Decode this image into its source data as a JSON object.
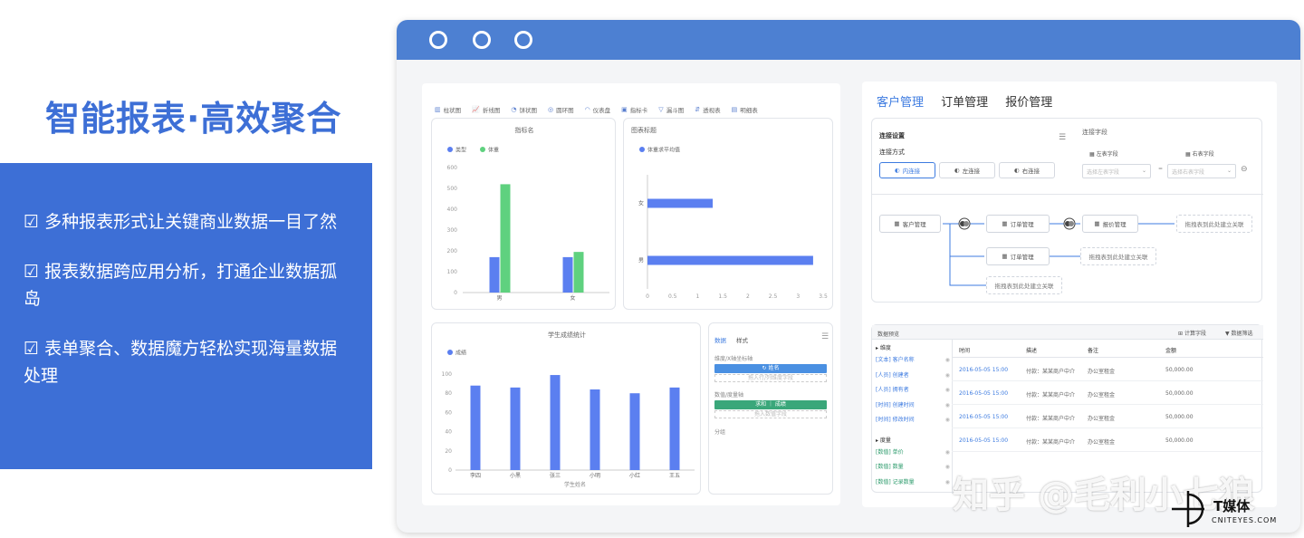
{
  "headline": "智能报表·高效聚合",
  "features": [
    "☑ 多种报表形式让关键商业数据一目了然",
    "☑ 报表数据跨应用分析，打通企业数据孤岛",
    "☑ 表单聚合、数据魔方轻松实现海量数据处理"
  ],
  "report": {
    "toolbar": [
      {
        "icon": "bar-chart-icon",
        "label": "柱状图"
      },
      {
        "icon": "line-chart-icon",
        "label": "折线图"
      },
      {
        "icon": "pie-chart-icon",
        "label": "饼状图"
      },
      {
        "icon": "ring-chart-icon",
        "label": "圆环图"
      },
      {
        "icon": "gauge-icon",
        "label": "仪表盘"
      },
      {
        "icon": "indicator-card-icon",
        "label": "指标卡"
      },
      {
        "icon": "funnel-icon",
        "label": "漏斗图"
      },
      {
        "icon": "pivot-table-icon",
        "label": "透视表"
      },
      {
        "icon": "detail-table-icon",
        "label": "明细表"
      }
    ],
    "chart1": {
      "title": "指标名",
      "legend": [
        "类型",
        "体重"
      ]
    },
    "chart2": {
      "title": "图表标题",
      "legend": [
        "体重求平均值"
      ]
    },
    "chart3": {
      "title": "学生成绩统计",
      "legend": [
        "成绩"
      ],
      "xlabel": "学生姓名"
    },
    "config": {
      "tabs": [
        "数据",
        "样式"
      ],
      "dim_label": "维度/X轴坐标轴",
      "dim_chip": "↻ 姓名",
      "dim_hint": "拖入行/列维度字段",
      "metric_label": "数值/度量轴",
      "metric_chip": "求和 ｜ 成绩",
      "metric_hint": "拖入数值字段",
      "filter_label": "分组"
    }
  },
  "chart_data": [
    {
      "type": "bar",
      "title": "指标名",
      "categories": [
        "男",
        "女"
      ],
      "series": [
        {
          "name": "类型",
          "values": [
            170,
            170
          ]
        },
        {
          "name": "体重",
          "values": [
            520,
            195
          ]
        }
      ],
      "ylim": [
        0,
        600
      ],
      "yticks": [
        0,
        100,
        200,
        300,
        400,
        500,
        600
      ],
      "colors": [
        "#5b7ff0",
        "#5fd17f"
      ],
      "legend": "top-left"
    },
    {
      "type": "bar",
      "orientation": "horizontal",
      "title": "图表标题",
      "categories": [
        "女",
        "男"
      ],
      "series": [
        {
          "name": "体重求平均值",
          "values": [
            1.3,
            3.3
          ]
        }
      ],
      "xlim": [
        0,
        3.5
      ],
      "xticks": [
        "0",
        "0.5",
        "1",
        "1.5",
        "2",
        "2.5",
        "3",
        "3.5"
      ],
      "colors": [
        "#5b7ff0"
      ]
    },
    {
      "type": "bar",
      "title": "学生成绩统计",
      "categories": [
        "李四",
        "小黑",
        "张三",
        "小明",
        "小红",
        "王五"
      ],
      "series": [
        {
          "name": "成绩",
          "values": [
            88,
            86,
            99,
            84,
            80,
            86
          ]
        }
      ],
      "ylim": [
        0,
        100
      ],
      "yticks": [
        0,
        20,
        40,
        60,
        80,
        100
      ],
      "xlabel": "学生姓名",
      "colors": [
        "#5b7ff0"
      ]
    }
  ],
  "right": {
    "tabs": [
      "客户管理",
      "订单管理",
      "报价管理"
    ],
    "conn": {
      "title": "连接设置",
      "method": "连接方式",
      "buttons": [
        "内连接",
        "左连接",
        "右连接"
      ],
      "fields_title": "连接字段",
      "left_field": "左表字段",
      "right_field": "右表字段",
      "left_placeholder": "选择左表字段",
      "right_placeholder": "选择右表字段",
      "flow": [
        "客户管理",
        "订单管理",
        "报价管理",
        "订单管理"
      ],
      "drop_hint": "拖拽表到此处建立关联"
    },
    "preview": {
      "title": "数据预览",
      "calc_btn": "计算字段",
      "filter_btn": "数据筛选",
      "groups": [
        {
          "name": "▸ 维度",
          "fields": [
            "[文本] 客户名称",
            "[人员] 创建者",
            "[人员] 拥有者",
            "[时间] 创建时间",
            "[时间] 修改时间"
          ]
        },
        {
          "name": "▸ 度量",
          "fields": [
            "[数值] 单价",
            "[数值] 数量",
            "[数值] 记录数量"
          ]
        }
      ],
      "columns": [
        "时间",
        "描述",
        "备注",
        "金额"
      ],
      "rows": [
        [
          "2016-05-05 15:00",
          "付款：某某商户中介",
          "办公室租金",
          "50,000.00"
        ],
        [
          "2016-05-05 15:00",
          "付款：某某商户中介",
          "办公室租金",
          "50,000.00"
        ],
        [
          "2016-05-05 15:00",
          "付款：某某商户中介",
          "办公室租金",
          "50,000.00"
        ],
        [
          "2016-05-05 15:00",
          "付款：某某商户中介",
          "办公室租金",
          "50,000.00"
        ]
      ]
    }
  },
  "watermark": "知乎 @毛利小七狼",
  "logo": {
    "main": "T媒体",
    "sub": "CNITEYES.COM"
  }
}
